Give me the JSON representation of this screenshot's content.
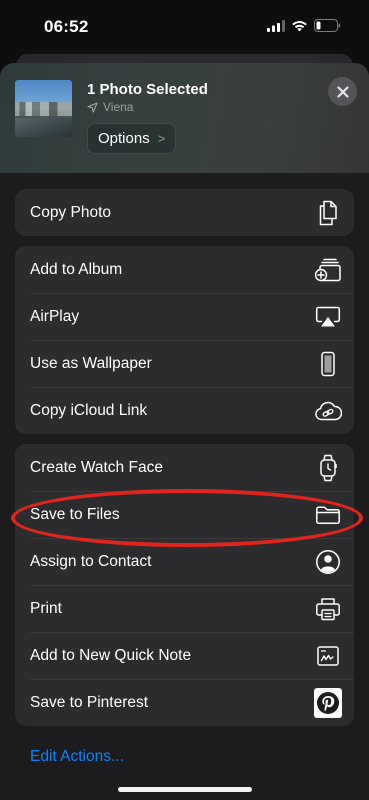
{
  "status_bar": {
    "time": "06:52"
  },
  "header": {
    "title": "1 Photo Selected",
    "location": "Viena",
    "options_label": "Options",
    "options_chevron": ">"
  },
  "groups": [
    {
      "items": [
        {
          "label": "Copy Photo",
          "icon": "copy-icon"
        }
      ]
    },
    {
      "items": [
        {
          "label": "Add to Album",
          "icon": "add-to-album-icon"
        },
        {
          "label": "AirPlay",
          "icon": "airplay-icon"
        },
        {
          "label": "Use as Wallpaper",
          "icon": "phone-icon"
        },
        {
          "label": "Copy iCloud Link",
          "icon": "cloud-link-icon"
        }
      ]
    },
    {
      "items": [
        {
          "label": "Create Watch Face",
          "icon": "watch-icon"
        },
        {
          "label": "Save to Files",
          "icon": "folder-icon"
        },
        {
          "label": "Assign to Contact",
          "icon": "contact-icon"
        },
        {
          "label": "Print",
          "icon": "printer-icon"
        },
        {
          "label": "Add to New Quick Note",
          "icon": "quick-note-icon"
        },
        {
          "label": "Save to Pinterest",
          "icon": "pinterest-icon"
        }
      ]
    }
  ],
  "edit_actions": "Edit Actions...",
  "colors": {
    "accent": "#0a84ff",
    "highlight": "#e0261b",
    "row_bg": "#2c2c2e",
    "sheet_bg": "#1c1c1e"
  }
}
